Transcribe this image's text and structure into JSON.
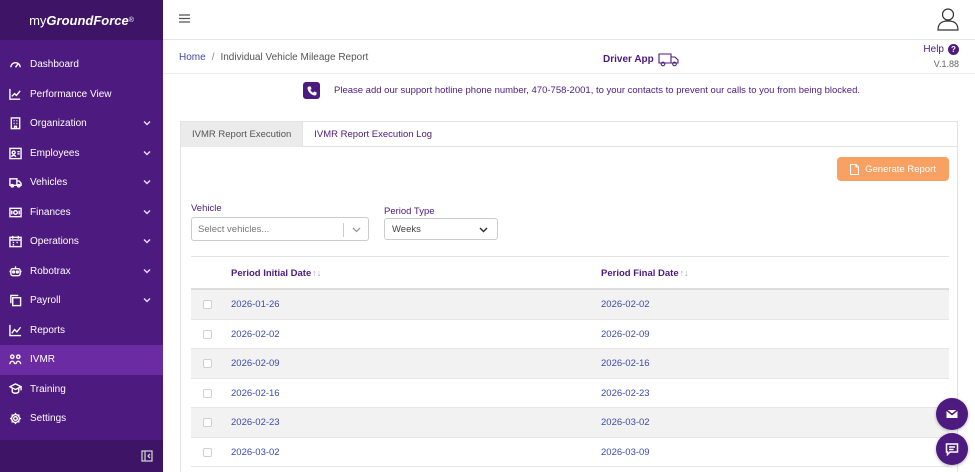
{
  "app": {
    "logo_prefix": "my",
    "logo_brand": "GroundForce",
    "logo_mark": "®"
  },
  "sidebar": {
    "items": [
      {
        "label": "Dashboard",
        "icon": "dashboard-icon",
        "has_submenu": false
      },
      {
        "label": "Performance View",
        "icon": "chart-line-icon",
        "has_submenu": false
      },
      {
        "label": "Organization",
        "icon": "building-icon",
        "has_submenu": true
      },
      {
        "label": "Employees",
        "icon": "id-card-icon",
        "has_submenu": true
      },
      {
        "label": "Vehicles",
        "icon": "truck-icon",
        "has_submenu": true
      },
      {
        "label": "Finances",
        "icon": "money-icon",
        "has_submenu": true
      },
      {
        "label": "Operations",
        "icon": "calendar-icon",
        "has_submenu": true
      },
      {
        "label": "Robotrax",
        "icon": "robot-icon",
        "has_submenu": true
      },
      {
        "label": "Payroll",
        "icon": "copy-icon",
        "has_submenu": true
      },
      {
        "label": "Reports",
        "icon": "reports-icon",
        "has_submenu": false
      },
      {
        "label": "IVMR",
        "icon": "ivmr-icon",
        "has_submenu": false,
        "active": true
      },
      {
        "label": "Training",
        "icon": "training-icon",
        "has_submenu": false
      },
      {
        "label": "Settings",
        "icon": "gear-icon",
        "has_submenu": false
      }
    ]
  },
  "breadcrumb": {
    "home": "Home",
    "separator": "/",
    "current": "Individual Vehicle Mileage Report"
  },
  "header": {
    "driver_app": "Driver App",
    "help": "Help",
    "help_mark": "?",
    "version": "V.1.88"
  },
  "notice": {
    "message": "Please add our support hotline phone number, 470-758-2001, to your contacts to prevent our calls to you from being blocked."
  },
  "tabs": [
    {
      "label": "IVMR Report Execution",
      "active": true
    },
    {
      "label": "IVMR Report Execution Log",
      "active": false
    }
  ],
  "actions": {
    "generate_report": "Generate Report"
  },
  "form": {
    "vehicle_label": "Vehicle",
    "vehicle_placeholder": "Select vehicles...",
    "period_type_label": "Period Type",
    "period_type_value": "Weeks"
  },
  "table": {
    "columns": [
      "Period Initial Date",
      "Period Final Date"
    ],
    "sort_glyph": "↑↓",
    "rows": [
      [
        "2026-01-26",
        "2026-02-02"
      ],
      [
        "2026-02-02",
        "2026-02-09"
      ],
      [
        "2026-02-09",
        "2026-02-16"
      ],
      [
        "2026-02-16",
        "2026-02-23"
      ],
      [
        "2026-02-23",
        "2026-03-02"
      ],
      [
        "2026-03-02",
        "2026-03-09"
      ]
    ]
  },
  "colors": {
    "sidebar": "#4d1a7f",
    "accent": "#4d1a7f",
    "button": "#f8a162",
    "link": "#3b4aa8"
  }
}
